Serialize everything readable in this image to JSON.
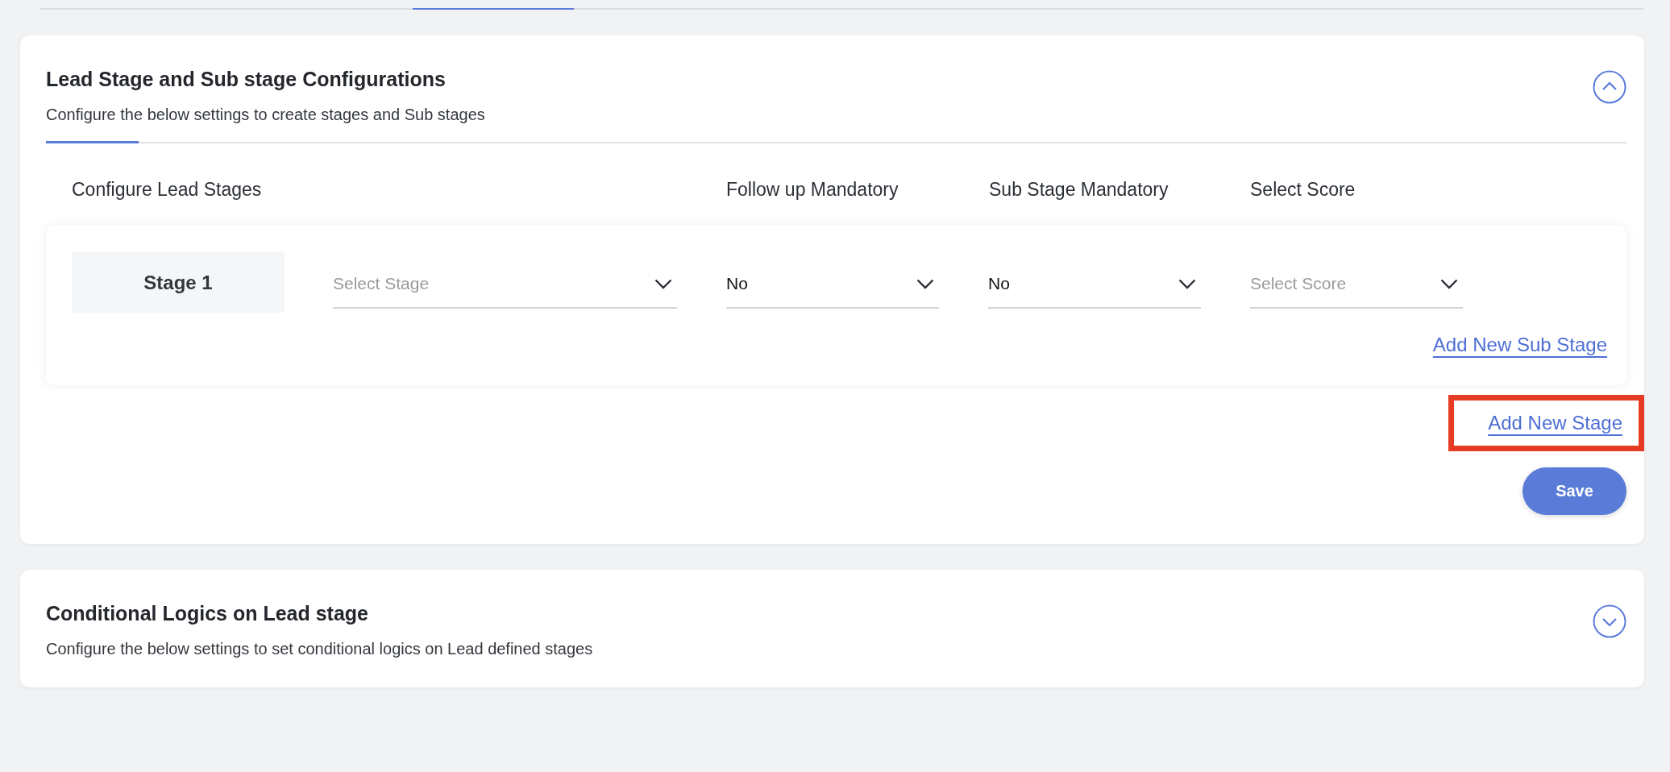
{
  "sections": [
    {
      "title": "Lead Stage and Sub stage Configurations",
      "subtitle": "Configure the below settings to create stages and Sub stages",
      "expanded": true,
      "columns": [
        "Configure Lead Stages",
        "Follow up Mandatory",
        "Sub Stage Mandatory",
        "Select Score"
      ],
      "stages": [
        {
          "label": "Stage 1",
          "fields": [
            {
              "placeholder": "Select Stage"
            },
            {
              "value": "No"
            },
            {
              "value": "No"
            },
            {
              "placeholder": "Select Score"
            }
          ],
          "add_sub_stage": "Add New Sub Stage"
        }
      ],
      "add_stage": {
        "label": "Add New Stage",
        "highlighted": true
      },
      "save": "Save"
    },
    {
      "title": "Conditional Logics on Lead stage",
      "subtitle": "Configure the below settings to set conditional logics on Lead defined stages",
      "expanded": false
    }
  ]
}
